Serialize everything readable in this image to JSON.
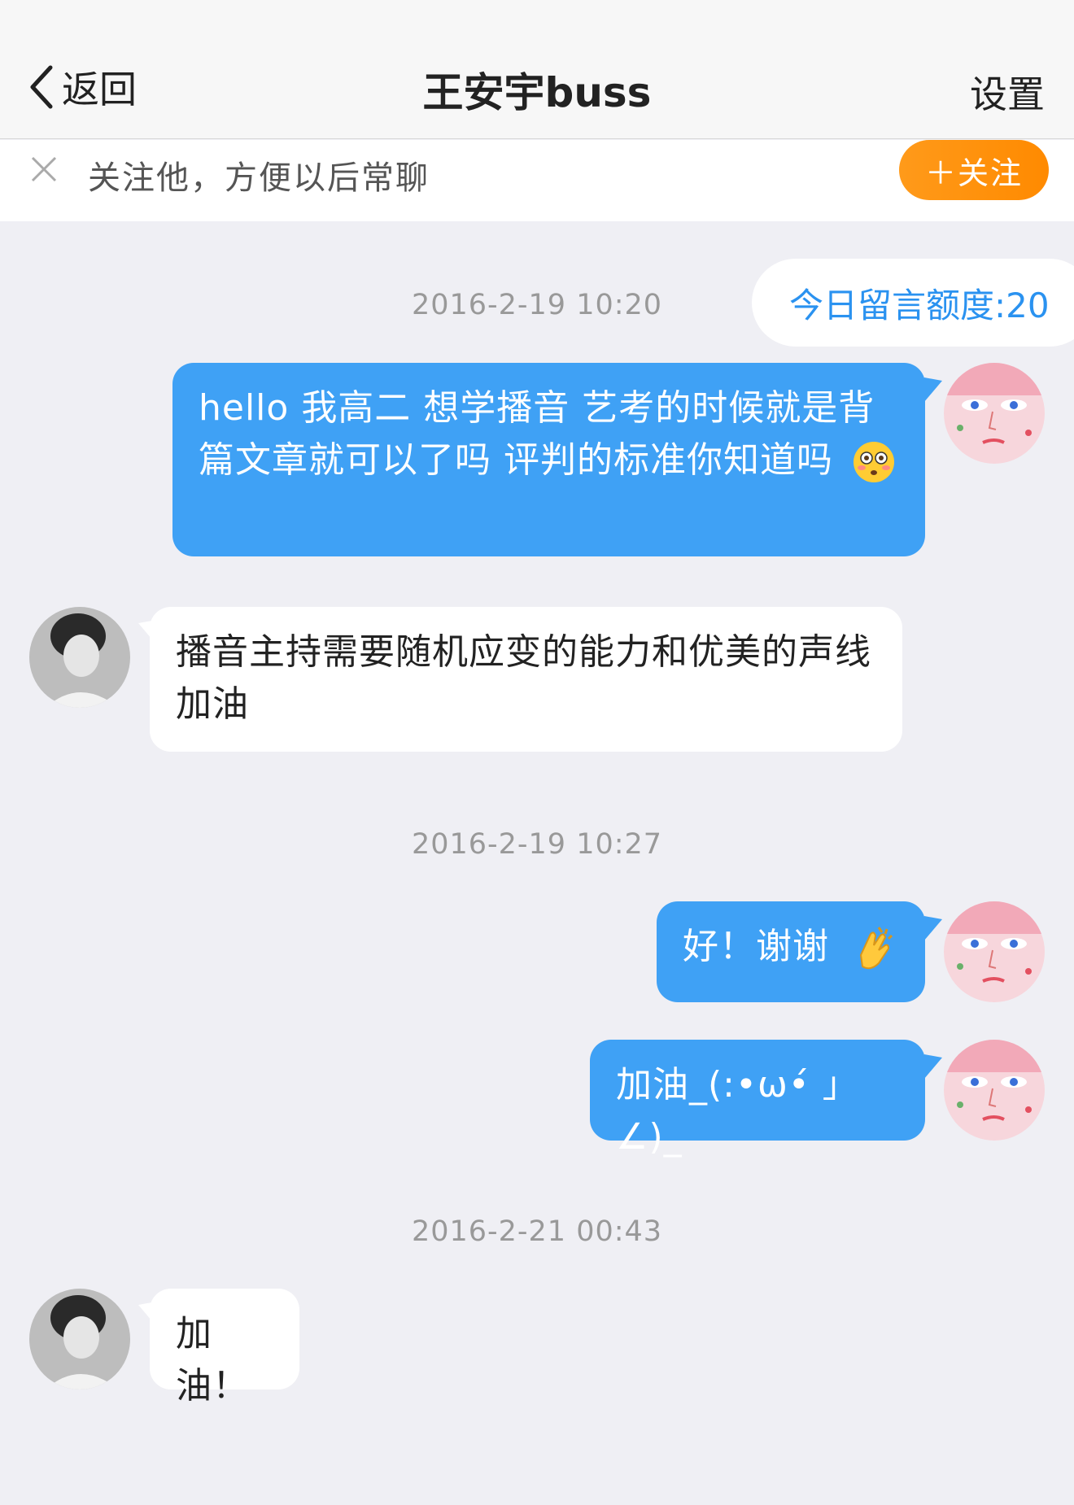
{
  "nav": {
    "back_label": "返回",
    "title": "王安宇buss",
    "settings_label": "设置"
  },
  "follow_bar": {
    "prompt": "关注他，方便以后常聊",
    "button_label": "＋关注"
  },
  "quota": {
    "label": "今日留言额度:20"
  },
  "messages": [
    {
      "type": "timestamp",
      "text": "2016-2-19 10:20"
    },
    {
      "type": "sent",
      "text": "hello 我高二 想学播音 艺考的时候就是背篇文章就可以了吗 评判的标准你知道吗",
      "emoji": "flushed-face-icon"
    },
    {
      "type": "received",
      "text": "播音主持需要随机应变的能力和优美的声线 加油"
    },
    {
      "type": "timestamp",
      "text": "2016-2-19 10:27"
    },
    {
      "type": "sent",
      "text": "好！谢谢",
      "emoji": "clapping-hands-icon"
    },
    {
      "type": "sent",
      "text": "加油_(:•ω•́ 」∠)_"
    },
    {
      "type": "timestamp",
      "text": "2016-2-21 00:43"
    },
    {
      "type": "received",
      "text": "加油！"
    }
  ],
  "colors": {
    "sent_bubble": "#3fa1f5",
    "received_bubble": "#ffffff",
    "follow_button": "#ff8a00",
    "quota_text": "#2a92f0",
    "background": "#efeff4"
  }
}
